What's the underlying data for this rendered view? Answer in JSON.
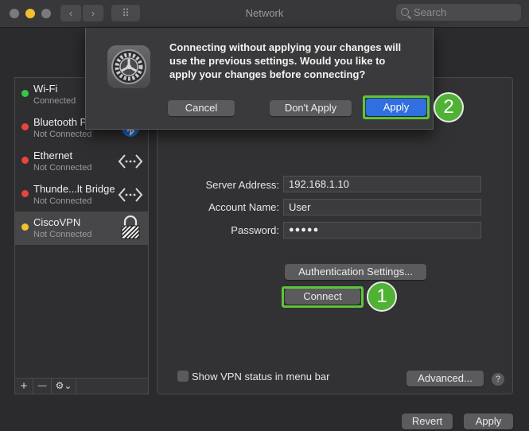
{
  "window": {
    "title": "Network",
    "search_placeholder": "Search",
    "nav_back": "‹",
    "nav_forward": "›",
    "grid_button": "⠿"
  },
  "sidebar": {
    "items": [
      {
        "name": "Wi-Fi",
        "status": "Connected",
        "status_color": "#32c84a"
      },
      {
        "name": "Bluetooth PAN",
        "status": "Not Connected",
        "status_color": "#e8453c"
      },
      {
        "name": "Ethernet",
        "status": "Not Connected",
        "status_color": "#e8453c"
      },
      {
        "name": "Thunde...lt Bridge",
        "status": "Not Connected",
        "status_color": "#e8453c"
      },
      {
        "name": "CiscoVPN",
        "status": "Not Connected",
        "status_color": "#f2c12e"
      }
    ],
    "add": "+",
    "remove": "—",
    "action": "⚙︎⌄"
  },
  "form": {
    "server_address_label": "Server Address:",
    "server_address_value": "192.168.1.10",
    "account_name_label": "Account Name:",
    "account_name_value": "User",
    "password_label": "Password:",
    "password_value": "●●●●●",
    "auth_settings": "Authentication Settings...",
    "connect": "Connect",
    "show_vpn_status": "Show VPN status in menu bar",
    "advanced": "Advanced...",
    "help": "?"
  },
  "footer": {
    "revert": "Revert",
    "apply": "Apply"
  },
  "sheet": {
    "message": "Connecting without applying your changes will\nuse the previous settings. Would you like to\napply your changes before connecting?",
    "cancel": "Cancel",
    "dont_apply": "Don't Apply",
    "apply": "Apply"
  },
  "annotations": {
    "step1": "1",
    "step2": "2",
    "highlight_color": "#5cc63b"
  }
}
